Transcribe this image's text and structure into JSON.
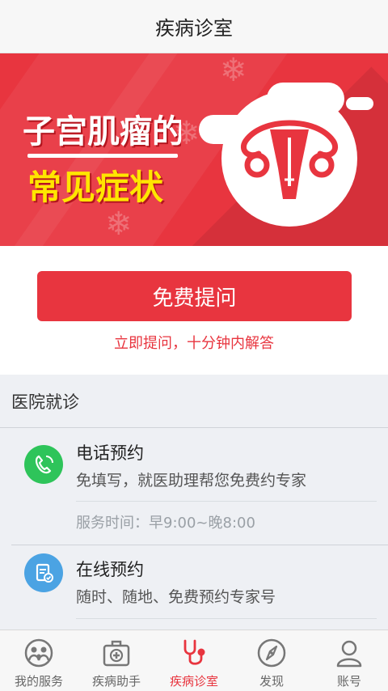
{
  "header": {
    "title": "疾病诊室"
  },
  "banner": {
    "line1": "子宫肌瘤的",
    "line2": "常见症状"
  },
  "ask": {
    "button_label": "免费提问",
    "subtitle": "立即提问，十分钟内解答"
  },
  "hospital": {
    "section_title": "医院就诊",
    "items": [
      {
        "name": "电话预约",
        "desc": "免填写，就医助理帮您免费约专家",
        "hours": "服务时间：早9:00~晚8:00",
        "icon": "phone-icon",
        "color": "#2ec45a"
      },
      {
        "name": "在线预约",
        "desc": "随时、随地、免费预约专家号",
        "icon": "clipboard-check-icon",
        "color": "#4ba3e3"
      }
    ]
  },
  "tabbar": {
    "tabs": [
      {
        "label": "我的服务",
        "icon": "family-icon"
      },
      {
        "label": "疾病助手",
        "icon": "medkit-icon"
      },
      {
        "label": "疾病诊室",
        "icon": "stethoscope-icon"
      },
      {
        "label": "发现",
        "icon": "compass-icon"
      },
      {
        "label": "账号",
        "icon": "user-icon"
      }
    ],
    "active_index": 2,
    "active_color": "#e8353f"
  }
}
